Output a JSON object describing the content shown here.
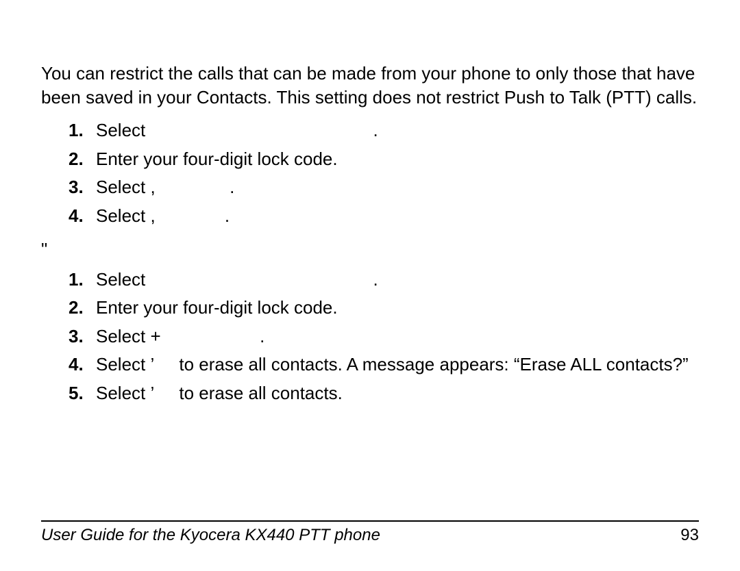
{
  "intro": "You can restrict the calls that can be made from your phone to only those that have been saved in your Contacts. This setting does not restrict Push to Talk (PTT) calls.",
  "section1": {
    "items": [
      "Select                                              .",
      "Enter your four-digit lock code.",
      "Select ,               .",
      "Select ,              ."
    ]
  },
  "section_marker": "\"",
  "section2": {
    "items": [
      "Select                                              .",
      "Enter your four-digit lock code.",
      "Select +                    .",
      "Select ’     to erase all contacts. A message appears: “Erase ALL contacts?”",
      "Select ’     to erase all contacts."
    ]
  },
  "footer": {
    "title": "User Guide for the Kyocera KX440 PTT phone",
    "page": "93"
  }
}
